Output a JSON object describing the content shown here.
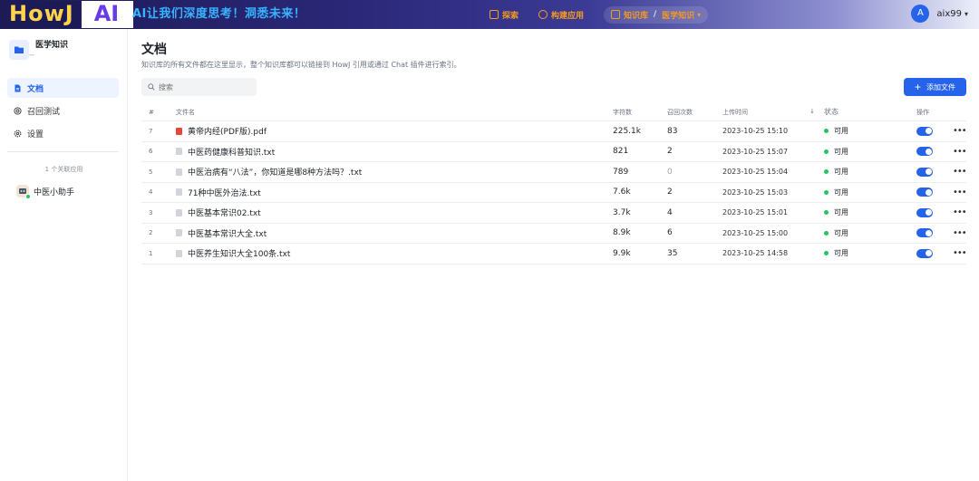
{
  "header": {
    "logo_left": "HowJ",
    "logo_right": "AI",
    "slogan": "AI让我们深度思考！洞悉未来！",
    "nav": {
      "explore": "探索",
      "build_app": "构建应用",
      "kb": "知识库",
      "separator": "/",
      "current_kb": "医学知识"
    },
    "user": {
      "avatar_letter": "A",
      "name": "aix99"
    }
  },
  "sidebar": {
    "kb_name": "医学知识",
    "kb_sub": "--",
    "items": [
      {
        "label": "文档"
      },
      {
        "label": "召回测试"
      },
      {
        "label": "设置"
      }
    ],
    "linked_label": "1 个关联应用",
    "linked_app": "中医小助手"
  },
  "main": {
    "title": "文档",
    "description": "知识库的所有文件都在这里显示，整个知识库都可以链接到 HowJ 引用或通过 Chat 插件进行索引。",
    "search_placeholder": "搜索",
    "add_button": "添加文件",
    "columns": {
      "idx": "#",
      "name": "文件名",
      "chars": "字符数",
      "recall": "召回次数",
      "time": "上传时间",
      "sort": "↓",
      "status": "状态",
      "op": "操作"
    },
    "rows": [
      {
        "idx": "7",
        "name": "黄帝内经(PDF版).pdf",
        "chars": "225.1k",
        "recall": "83",
        "time": "2023-10-25 15:10",
        "status": "可用",
        "type": "pdf"
      },
      {
        "idx": "6",
        "name": "中医药健康科普知识.txt",
        "chars": "821",
        "recall": "2",
        "time": "2023-10-25 15:07",
        "status": "可用",
        "type": "txt"
      },
      {
        "idx": "5",
        "name": "中医治病有“八法”，你知道是哪8种方法吗？.txt",
        "chars": "789",
        "recall": "0",
        "time": "2023-10-25 15:04",
        "status": "可用",
        "type": "txt"
      },
      {
        "idx": "4",
        "name": "71种中医外治法.txt",
        "chars": "7.6k",
        "recall": "2",
        "time": "2023-10-25 15:03",
        "status": "可用",
        "type": "txt"
      },
      {
        "idx": "3",
        "name": "中医基本常识02.txt",
        "chars": "3.7k",
        "recall": "4",
        "time": "2023-10-25 15:01",
        "status": "可用",
        "type": "txt"
      },
      {
        "idx": "2",
        "name": "中医基本常识大全.txt",
        "chars": "8.9k",
        "recall": "6",
        "time": "2023-10-25 15:00",
        "status": "可用",
        "type": "txt"
      },
      {
        "idx": "1",
        "name": "中医养生知识大全100条.txt",
        "chars": "9.9k",
        "recall": "35",
        "time": "2023-10-25 14:58",
        "status": "可用",
        "type": "txt"
      }
    ]
  }
}
